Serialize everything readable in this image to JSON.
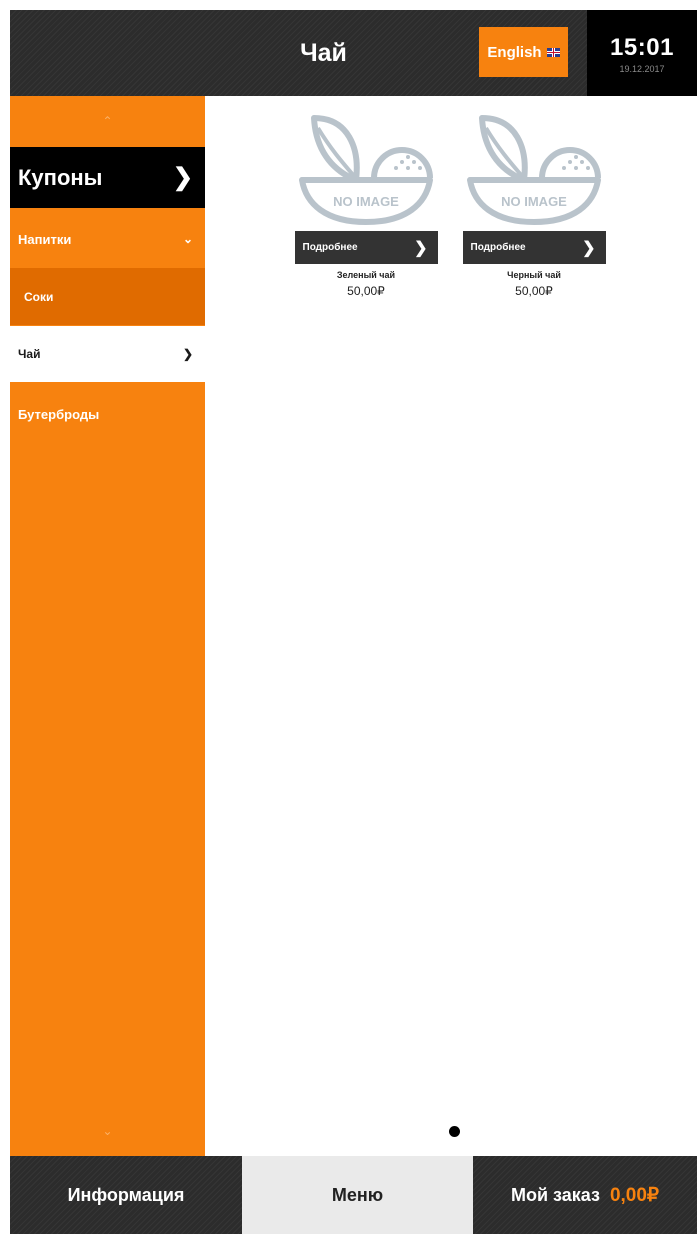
{
  "header": {
    "title": "Чай",
    "language_label": "English",
    "time": "15:01",
    "date": "19.12.2017"
  },
  "sidebar": {
    "scroll_up_icon": "chevron-up-icon",
    "coupons_label": "Купоны",
    "items": [
      {
        "label": "Напитки",
        "icon": "chevron-down-icon"
      },
      {
        "label": "Соки"
      },
      {
        "label": "Чай",
        "icon": "chevron-right-icon",
        "selected": true
      },
      {
        "label": "Бутерброды"
      }
    ],
    "scroll_down_icon": "chevron-down-icon"
  },
  "products": [
    {
      "image_text": "NO IMAGE",
      "details_label": "Подробнее",
      "name": "Зеленый чай",
      "price": "50,00₽"
    },
    {
      "image_text": "NO IMAGE",
      "details_label": "Подробнее",
      "name": "Черный чай",
      "price": "50,00₽"
    }
  ],
  "pagination": {
    "current": 1,
    "total": 1
  },
  "footer": {
    "info_label": "Информация",
    "menu_label": "Меню",
    "order_label": "Мой заказ",
    "order_amount": "0,00₽"
  },
  "colors": {
    "accent": "#f7820f",
    "accent_dark": "#e06b00",
    "dark": "#2c2c2c",
    "black": "#000000",
    "placeholder": "#b9c3cb"
  }
}
